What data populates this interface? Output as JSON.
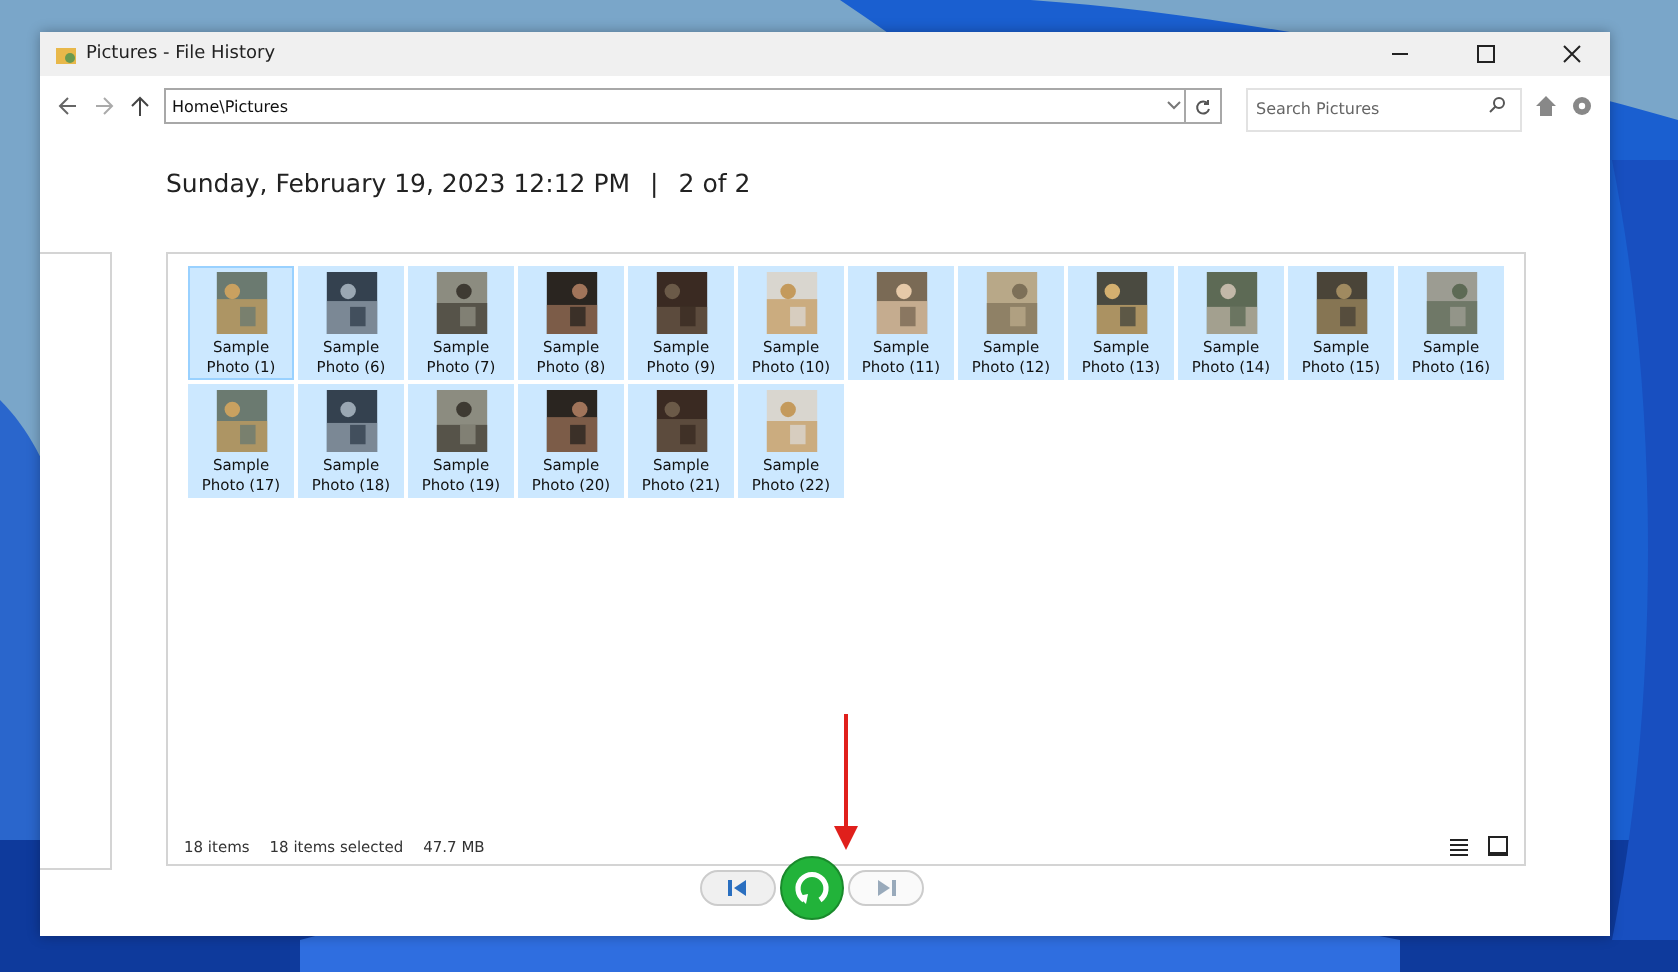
{
  "window": {
    "title": "Pictures - File History"
  },
  "toolbar": {
    "address": "Home\\Pictures",
    "search": {
      "placeholder": "Search Pictures"
    }
  },
  "heading": {
    "date": "Sunday, February 19, 2023 12:12 PM",
    "separator": "|",
    "position": "2 of 2"
  },
  "files": [
    {
      "name": "Sample Photo (1)",
      "selected": true,
      "focused": true
    },
    {
      "name": "Sample Photo (6)",
      "selected": true,
      "focused": false
    },
    {
      "name": "Sample Photo (7)",
      "selected": true,
      "focused": false
    },
    {
      "name": "Sample Photo (8)",
      "selected": true,
      "focused": false
    },
    {
      "name": "Sample Photo (9)",
      "selected": true,
      "focused": false
    },
    {
      "name": "Sample Photo (10)",
      "selected": true,
      "focused": false
    },
    {
      "name": "Sample Photo (11)",
      "selected": true,
      "focused": false
    },
    {
      "name": "Sample Photo (12)",
      "selected": true,
      "focused": false
    },
    {
      "name": "Sample Photo (13)",
      "selected": true,
      "focused": false
    },
    {
      "name": "Sample Photo (14)",
      "selected": true,
      "focused": false
    },
    {
      "name": "Sample Photo (15)",
      "selected": true,
      "focused": false
    },
    {
      "name": "Sample Photo (16)",
      "selected": true,
      "focused": false
    },
    {
      "name": "Sample Photo (17)",
      "selected": true,
      "focused": false
    },
    {
      "name": "Sample Photo (18)",
      "selected": true,
      "focused": false
    },
    {
      "name": "Sample Photo (19)",
      "selected": true,
      "focused": false
    },
    {
      "name": "Sample Photo (20)",
      "selected": true,
      "focused": false
    },
    {
      "name": "Sample Photo (21)",
      "selected": true,
      "focused": false
    },
    {
      "name": "Sample Photo (22)",
      "selected": true,
      "focused": false
    }
  ],
  "status_bar": {
    "count": "18 items",
    "selection": "18 items selected",
    "size": "47.7 MB"
  },
  "navigation": {
    "previous_disabled": false,
    "next_disabled": true
  }
}
